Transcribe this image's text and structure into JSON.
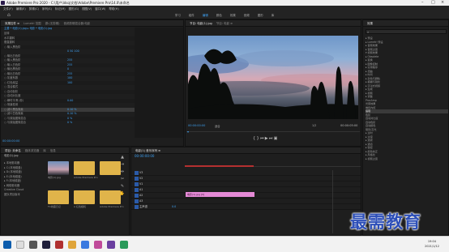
{
  "window": {
    "title": "Adobe Premiere Pro 2020 - C:\\用户\\ldsq\\文档\\Adobe\\Premiere Pro\\14.0\\未命名"
  },
  "menu": [
    "文件(F)",
    "编辑(E)",
    "剪辑(C)",
    "序列(S)",
    "标记(M)",
    "图形(G)",
    "视图(V)",
    "窗口(W)",
    "帮助(H)"
  ],
  "workspaces": {
    "items": [
      "学习",
      "组件",
      "编辑",
      "颜色",
      "效果",
      "音频",
      "图形",
      "库"
    ],
    "active": "编辑"
  },
  "effect_controls": {
    "tabs": [
      "效果控件 ≡",
      "Lumetri 范围",
      "源:(无剪辑)",
      "音频剪辑混合器:电影"
    ],
    "header": "主要 * 电影(1).jpg  ▸  电影 * 电影(1).jpg",
    "rows": [
      {
        "label": "反转",
        "value": "",
        "hl": false
      },
      {
        "label": "水平翻转",
        "value": "",
        "hl": false
      },
      {
        "label": "垂直翻转",
        "value": "",
        "hl": false
      },
      {
        "label": "○ 输入黑色阶",
        "value": "",
        "hl": false
      },
      {
        "label": "",
        "value": "0  50  100",
        "hl": false
      },
      {
        "label": "○ 输出白色阶",
        "value": "",
        "hl": false
      },
      {
        "label": "○ 输入黑色阶",
        "value": "255",
        "hl": false
      },
      {
        "label": "○ 输入白色阶",
        "value": "255",
        "hl": false
      },
      {
        "label": "○ 输出黑色阶",
        "value": "0",
        "hl": false
      },
      {
        "label": "○ 输出白色阶",
        "value": "255",
        "hl": false
      },
      {
        "label": "○ 灰度系数",
        "value": "100",
        "hl": false
      },
      {
        "label": "○ 红色增益",
        "value": "100",
        "hl": false
      },
      {
        "label": "○ 混合模式",
        "value": "",
        "hl": false
      },
      {
        "label": "○ 自动色阶",
        "value": "",
        "hl": false
      },
      {
        "label": "○ 自动对比度",
        "value": "",
        "hl": false
      },
      {
        "label": "○ 瞬时平滑 (秒)",
        "value": "0.00",
        "hl": false
      },
      {
        "label": "○ 场景检测",
        "value": "",
        "hl": false
      },
      {
        "label": "○ 减少黑色像素",
        "value": "0.10 %",
        "hl": true
      },
      {
        "label": "○ 减少白色像素",
        "value": "0.10 %",
        "hl": false
      },
      {
        "label": "○ 与原始图像混合",
        "value": "0 %",
        "hl": false
      },
      {
        "label": "○ 与原始图像混合",
        "value": "0 %",
        "hl": false
      }
    ],
    "timecode": "00:00:00:00"
  },
  "program_monitor": {
    "tabs": [
      "节目: 电影(1).jpg",
      "节目: 电影 ≡"
    ],
    "timecode_left": "00:00:00:00",
    "fit": "适合",
    "quality": "1/2",
    "timecode_right": "00:00:05:00"
  },
  "project": {
    "tabs": [
      "项目: 未命名",
      "媒体浏览器",
      "库",
      "信息"
    ],
    "title": "电影(1).jpg",
    "tree": [
      "▸ 本地驱动器",
      "  ▸ C:(本地磁盘)",
      "  ▸ D:(本地磁盘)",
      "  ▸ E:(本地磁盘)",
      "  ▸ F:(本地磁盘)",
      "▸ 网络驱动器",
      "Creative Cloud",
      "  团队项目版本"
    ],
    "items": [
      "电影(1).jpg",
      "Adobe Premiere Pro",
      "",
      "FC收藏日记",
      "A 红色相机",
      "Adobe Premiere Pro"
    ]
  },
  "timeline": {
    "tab": "电影(1)  音乐序列 ≡",
    "timecode": "00:00:00:00",
    "tracks": [
      "V3",
      "V2",
      "V1",
      "A1",
      "A2",
      "A3",
      "主声道"
    ],
    "clip": "电影(1).jpg [V]",
    "master": "0.0"
  },
  "effects": {
    "title": "效果",
    "items": [
      "▸ 预设",
      "▸ Lumetri 预设",
      "▸ 音频效果",
      "▸ 音频过渡",
      "▾ 视频效果",
      "  ▸ Obsolete",
      "  ▸ 变换",
      "  ▸ 图像控制",
      "  ▸ 实用程序",
      "  ▸ 扭曲",
      "  ▸ 时间",
      "  ▸ 杂色与颗粒",
      "  ▸ 模糊与锐化",
      "  ▸ 沉浸式视频",
      "  ▸ 生成",
      "  ▸ 视频",
      "  ▸ 调整",
      "    ProcAmp",
      "    光照效果",
      "    卷积内核",
      "    提取",
      "    色阶",
      "    自动对比度",
      "    自动色阶",
      "    自动颜色",
      "    阴影/高光",
      "  ▸ 过时",
      "  ▸ 过渡",
      "  ▸ 透视",
      "  ▸ 通道",
      "  ▸ 键控",
      "  ▸ 颜色校正",
      "  ▸ 风格化",
      "▸ 视频过渡"
    ],
    "selected": 20
  },
  "taskbar": {
    "time": "19:04",
    "date": "2021/1/12"
  },
  "watermark": "最需教育"
}
